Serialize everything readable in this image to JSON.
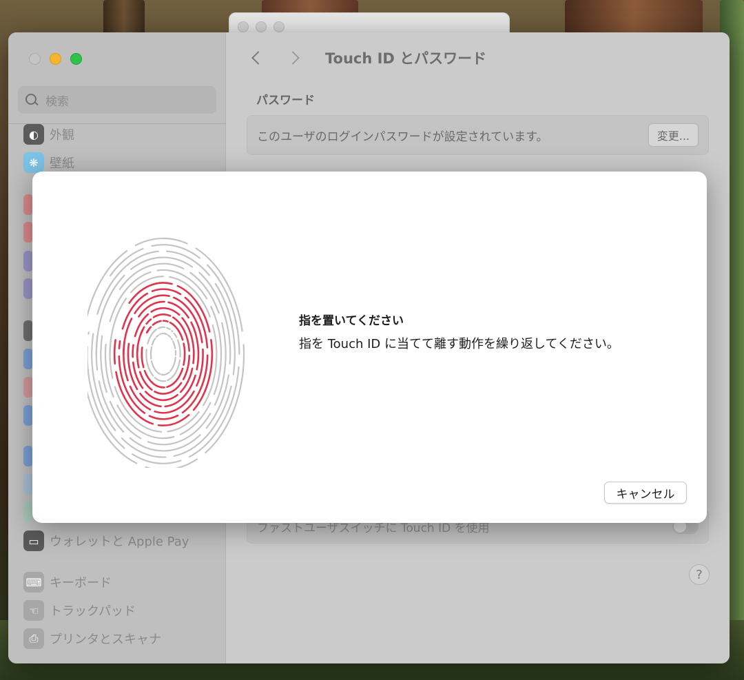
{
  "app": {
    "title": "Touch ID とパスワード"
  },
  "sidebar": {
    "search_placeholder": "検索",
    "items": [
      {
        "label": "外観",
        "icon": "appearance-icon",
        "color": "#5b5b5b"
      },
      {
        "label": "壁紙",
        "icon": "wallpaper-icon",
        "color": "#4fb6e8"
      },
      {
        "label": "ウォレットと Apple Pay",
        "icon": "wallet-icon",
        "color": "#3c3c3c"
      },
      {
        "label": "キーボード",
        "icon": "keyboard-icon",
        "color": "#9a9a9a"
      },
      {
        "label": "トラックパッド",
        "icon": "trackpad-icon",
        "color": "#9a9a9a"
      },
      {
        "label": "プリンタとスキャナ",
        "icon": "printer-icon",
        "color": "#9a9a9a"
      }
    ]
  },
  "content": {
    "section_title": "パスワード",
    "password_text": "このユーザのログインパスワードが設定されています。",
    "change_button": "変更...",
    "fast_user_switch": "ファストユーザスイッチに Touch ID を使用",
    "help_label": "?"
  },
  "sheet": {
    "title": "指を置いてください",
    "body": "指を Touch ID に当てて離す動作を繰り返してください。",
    "cancel_label": "キャンセル",
    "accent_color": "#e0344c"
  }
}
